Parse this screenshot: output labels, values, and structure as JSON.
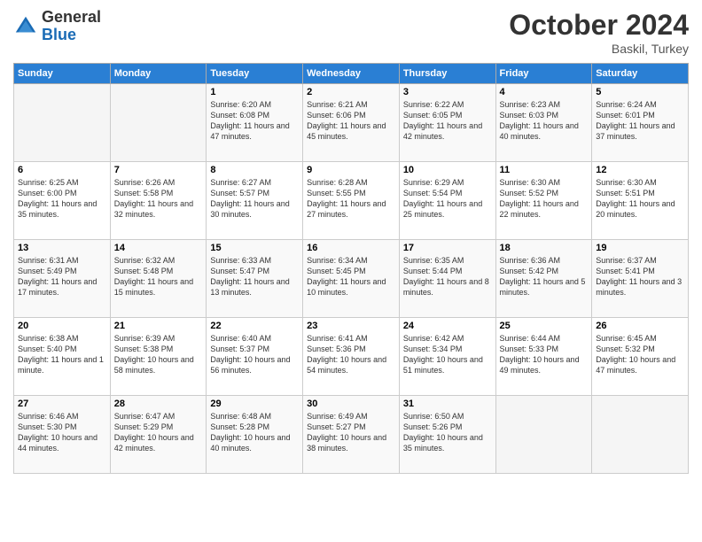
{
  "logo": {
    "general": "General",
    "blue": "Blue"
  },
  "header": {
    "month": "October 2024",
    "location": "Baskil, Turkey"
  },
  "days_of_week": [
    "Sunday",
    "Monday",
    "Tuesday",
    "Wednesday",
    "Thursday",
    "Friday",
    "Saturday"
  ],
  "weeks": [
    [
      {
        "day": "",
        "info": ""
      },
      {
        "day": "",
        "info": ""
      },
      {
        "day": "1",
        "info": "Sunrise: 6:20 AM\nSunset: 6:08 PM\nDaylight: 11 hours and 47 minutes."
      },
      {
        "day": "2",
        "info": "Sunrise: 6:21 AM\nSunset: 6:06 PM\nDaylight: 11 hours and 45 minutes."
      },
      {
        "day": "3",
        "info": "Sunrise: 6:22 AM\nSunset: 6:05 PM\nDaylight: 11 hours and 42 minutes."
      },
      {
        "day": "4",
        "info": "Sunrise: 6:23 AM\nSunset: 6:03 PM\nDaylight: 11 hours and 40 minutes."
      },
      {
        "day": "5",
        "info": "Sunrise: 6:24 AM\nSunset: 6:01 PM\nDaylight: 11 hours and 37 minutes."
      }
    ],
    [
      {
        "day": "6",
        "info": "Sunrise: 6:25 AM\nSunset: 6:00 PM\nDaylight: 11 hours and 35 minutes."
      },
      {
        "day": "7",
        "info": "Sunrise: 6:26 AM\nSunset: 5:58 PM\nDaylight: 11 hours and 32 minutes."
      },
      {
        "day": "8",
        "info": "Sunrise: 6:27 AM\nSunset: 5:57 PM\nDaylight: 11 hours and 30 minutes."
      },
      {
        "day": "9",
        "info": "Sunrise: 6:28 AM\nSunset: 5:55 PM\nDaylight: 11 hours and 27 minutes."
      },
      {
        "day": "10",
        "info": "Sunrise: 6:29 AM\nSunset: 5:54 PM\nDaylight: 11 hours and 25 minutes."
      },
      {
        "day": "11",
        "info": "Sunrise: 6:30 AM\nSunset: 5:52 PM\nDaylight: 11 hours and 22 minutes."
      },
      {
        "day": "12",
        "info": "Sunrise: 6:30 AM\nSunset: 5:51 PM\nDaylight: 11 hours and 20 minutes."
      }
    ],
    [
      {
        "day": "13",
        "info": "Sunrise: 6:31 AM\nSunset: 5:49 PM\nDaylight: 11 hours and 17 minutes."
      },
      {
        "day": "14",
        "info": "Sunrise: 6:32 AM\nSunset: 5:48 PM\nDaylight: 11 hours and 15 minutes."
      },
      {
        "day": "15",
        "info": "Sunrise: 6:33 AM\nSunset: 5:47 PM\nDaylight: 11 hours and 13 minutes."
      },
      {
        "day": "16",
        "info": "Sunrise: 6:34 AM\nSunset: 5:45 PM\nDaylight: 11 hours and 10 minutes."
      },
      {
        "day": "17",
        "info": "Sunrise: 6:35 AM\nSunset: 5:44 PM\nDaylight: 11 hours and 8 minutes."
      },
      {
        "day": "18",
        "info": "Sunrise: 6:36 AM\nSunset: 5:42 PM\nDaylight: 11 hours and 5 minutes."
      },
      {
        "day": "19",
        "info": "Sunrise: 6:37 AM\nSunset: 5:41 PM\nDaylight: 11 hours and 3 minutes."
      }
    ],
    [
      {
        "day": "20",
        "info": "Sunrise: 6:38 AM\nSunset: 5:40 PM\nDaylight: 11 hours and 1 minute."
      },
      {
        "day": "21",
        "info": "Sunrise: 6:39 AM\nSunset: 5:38 PM\nDaylight: 10 hours and 58 minutes."
      },
      {
        "day": "22",
        "info": "Sunrise: 6:40 AM\nSunset: 5:37 PM\nDaylight: 10 hours and 56 minutes."
      },
      {
        "day": "23",
        "info": "Sunrise: 6:41 AM\nSunset: 5:36 PM\nDaylight: 10 hours and 54 minutes."
      },
      {
        "day": "24",
        "info": "Sunrise: 6:42 AM\nSunset: 5:34 PM\nDaylight: 10 hours and 51 minutes."
      },
      {
        "day": "25",
        "info": "Sunrise: 6:44 AM\nSunset: 5:33 PM\nDaylight: 10 hours and 49 minutes."
      },
      {
        "day": "26",
        "info": "Sunrise: 6:45 AM\nSunset: 5:32 PM\nDaylight: 10 hours and 47 minutes."
      }
    ],
    [
      {
        "day": "27",
        "info": "Sunrise: 6:46 AM\nSunset: 5:30 PM\nDaylight: 10 hours and 44 minutes."
      },
      {
        "day": "28",
        "info": "Sunrise: 6:47 AM\nSunset: 5:29 PM\nDaylight: 10 hours and 42 minutes."
      },
      {
        "day": "29",
        "info": "Sunrise: 6:48 AM\nSunset: 5:28 PM\nDaylight: 10 hours and 40 minutes."
      },
      {
        "day": "30",
        "info": "Sunrise: 6:49 AM\nSunset: 5:27 PM\nDaylight: 10 hours and 38 minutes."
      },
      {
        "day": "31",
        "info": "Sunrise: 6:50 AM\nSunset: 5:26 PM\nDaylight: 10 hours and 35 minutes."
      },
      {
        "day": "",
        "info": ""
      },
      {
        "day": "",
        "info": ""
      }
    ]
  ]
}
